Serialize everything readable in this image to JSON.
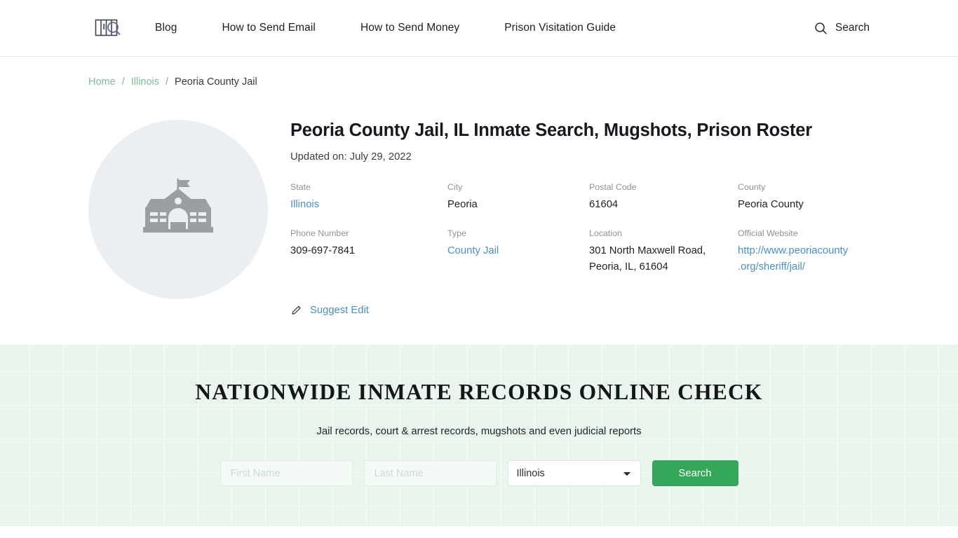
{
  "header": {
    "logo_name": "jail-bars-search-logo",
    "nav": [
      {
        "label": "Blog"
      },
      {
        "label": "How to Send Email"
      },
      {
        "label": "How to Send Money"
      },
      {
        "label": "Prison Visitation Guide"
      }
    ],
    "search_label": "Search"
  },
  "breadcrumb": {
    "home": "Home",
    "sep1": "/",
    "state": "Illinois",
    "sep2": "/",
    "current": "Peoria County Jail"
  },
  "entity": {
    "thumb_icon": "government-building-icon",
    "title": "Peoria County Jail, IL Inmate Search, Mugshots, Prison Roster",
    "updated": "Updated on: July 29, 2022",
    "facts": [
      {
        "label": "State",
        "value": "Illinois",
        "is_link": true
      },
      {
        "label": "City",
        "value": "Peoria",
        "is_link": false
      },
      {
        "label": "Postal Code",
        "value": "61604",
        "is_link": false
      },
      {
        "label": "County",
        "value": "Peoria County",
        "is_link": false
      },
      {
        "label": "Phone Number",
        "value": "309-697-7841",
        "is_link": false
      },
      {
        "label": "Type",
        "value": "County Jail",
        "is_link": true
      },
      {
        "label": "Location",
        "value": "301 North Maxwell Road, Peoria, IL, 61604",
        "is_link": false
      },
      {
        "label": "Official Website",
        "value": "http://www.peoriacounty.org/sheriff/jail/",
        "is_link": true
      }
    ],
    "suggest_edit_label": "Suggest Edit",
    "suggest_edit_icon": "pencil-icon"
  },
  "promo": {
    "title": "NATIONWIDE INMATE RECORDS ONLINE CHECK",
    "subtitle": "Jail records, court & arrest records, mugshots and even judicial reports",
    "first_name_placeholder": "First Name",
    "first_name_value": "",
    "last_name_placeholder": "Last Name",
    "last_name_value": "",
    "state_selected": "Illinois",
    "state_options": [
      "Illinois"
    ],
    "search_button_label": "Search"
  },
  "colors": {
    "accent_green": "#35a75b",
    "promo_background": "#e9f5ed",
    "link_blue": "#4a90c4",
    "breadcrumb_green": "#7bbf93",
    "thumb_background": "#eceff2"
  }
}
